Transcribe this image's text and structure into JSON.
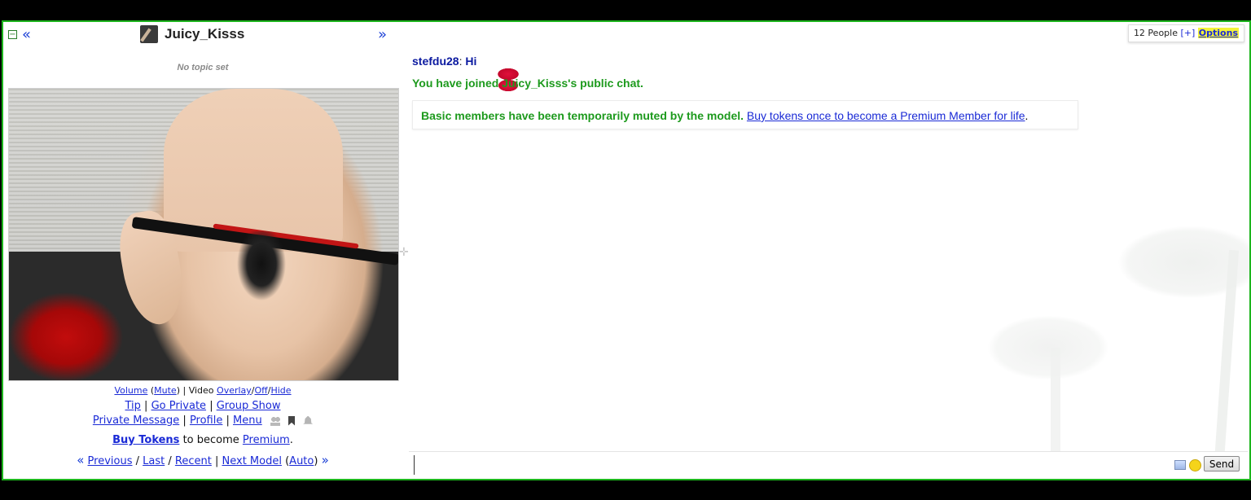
{
  "model": {
    "name": "Juicy_Kisss",
    "topic": "No topic set",
    "prev_symbol": "«",
    "next_symbol": "»"
  },
  "video_controls": {
    "volume": "Volume",
    "mute": "Mute",
    "video_label": "Video",
    "overlay": "Overlay",
    "off": "Off",
    "hide": "Hide"
  },
  "actions": {
    "tip": "Tip",
    "go_private": "Go Private",
    "group_show": "Group Show",
    "private_message": "Private Message",
    "profile": "Profile",
    "menu": "Menu"
  },
  "promo": {
    "buy_tokens": "Buy Tokens",
    "middle_text": "to become",
    "premium": "Premium",
    "period": "."
  },
  "model_nav": {
    "previous": "Previous",
    "last": "Last",
    "recent": "Recent",
    "next_model": "Next Model",
    "auto": "Auto"
  },
  "chat": {
    "people_count": "12 People",
    "plus": "[+]",
    "options": "Options",
    "messages": [
      {
        "user": "stefdu28",
        "text": "Hi"
      },
      {
        "system": "You have joined Juicy_Kisss's public chat."
      }
    ],
    "notice": {
      "text": "Basic members have been temporarily muted by the model.",
      "link": "Buy tokens once to become a Premium Member for life",
      "end": "."
    },
    "input_value": "",
    "send_label": "Send"
  },
  "colors": {
    "frame_border": "#1db51d",
    "link": "#1a2ad6",
    "system_text": "#1d9a1d",
    "username": "#0b1aa0",
    "options_highlight": "#f3f33a"
  },
  "icons": [
    "collapse-icon",
    "model-avatar-icon",
    "users-icon",
    "bookmark-icon",
    "bell-icon",
    "kiss-icon",
    "image-icon",
    "smiley-icon",
    "resize-handle-icon"
  ]
}
